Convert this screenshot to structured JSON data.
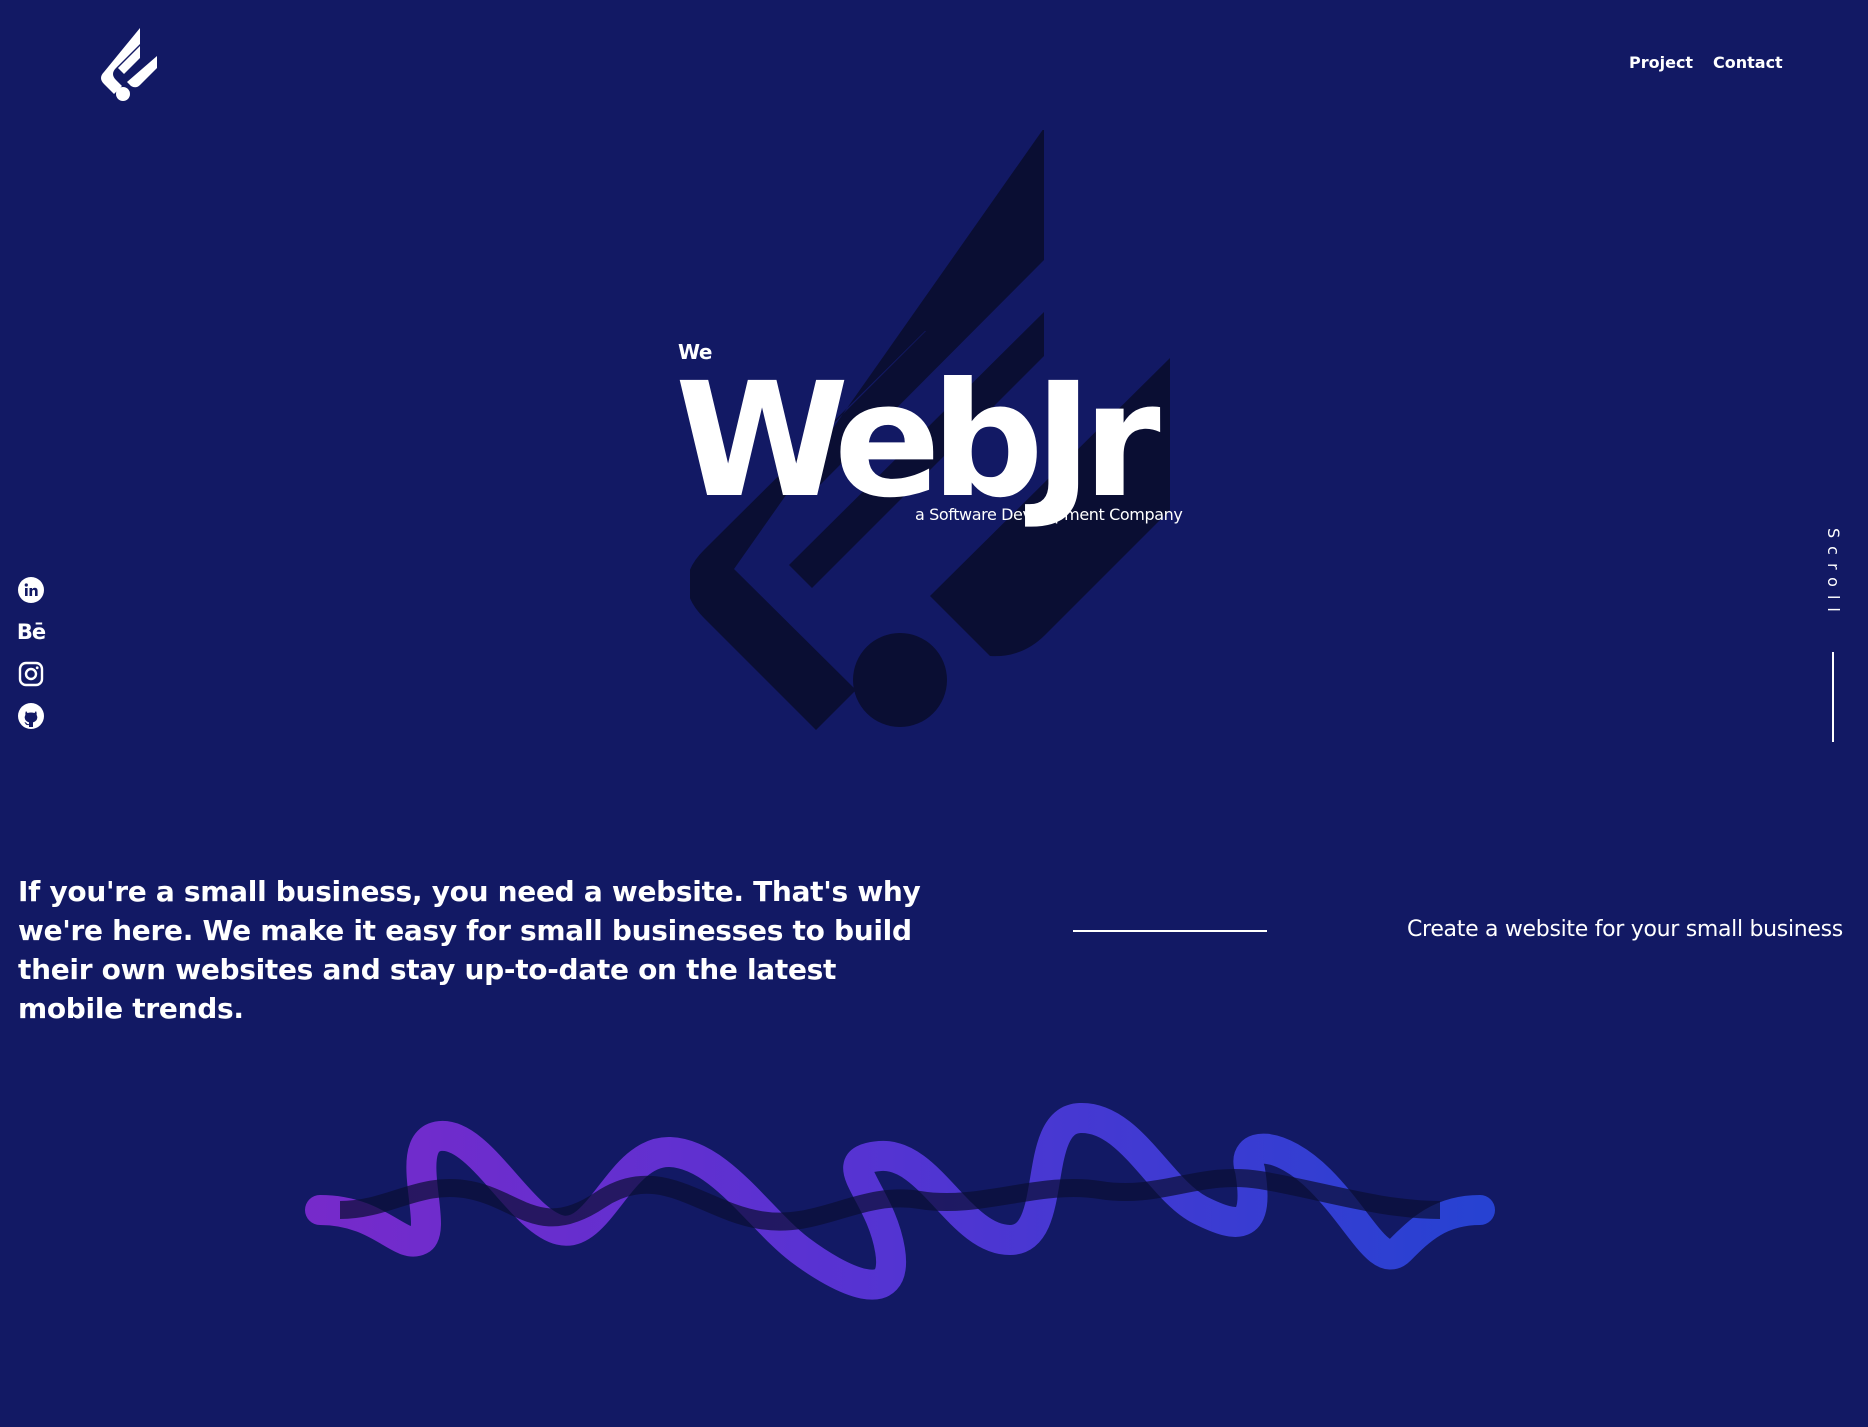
{
  "header": {
    "logo_icon": "webjr-logo-icon",
    "nav": {
      "project_label": "Project",
      "contact_label": "Contact"
    }
  },
  "hero": {
    "prefix": "We",
    "title": "WebJr",
    "subtitle": "a Software Development Company"
  },
  "socials": {
    "linkedin_icon": "linkedin-icon",
    "behance_label": "Bē",
    "instagram_icon": "instagram-icon",
    "github_icon": "github-icon"
  },
  "scroll": {
    "label": "Scroll"
  },
  "content": {
    "intro": "If you're a small business, you need a website. That's why we're here. We make it easy for small businesses to build their own websites and stay up-to-date on the latest mobile trends.",
    "tagline": "Create a website for your small business"
  },
  "colors": {
    "background": "#121964",
    "mark": "#0a0e33",
    "wave_purple": "#7b2bd0",
    "wave_blue": "#2844d8"
  }
}
